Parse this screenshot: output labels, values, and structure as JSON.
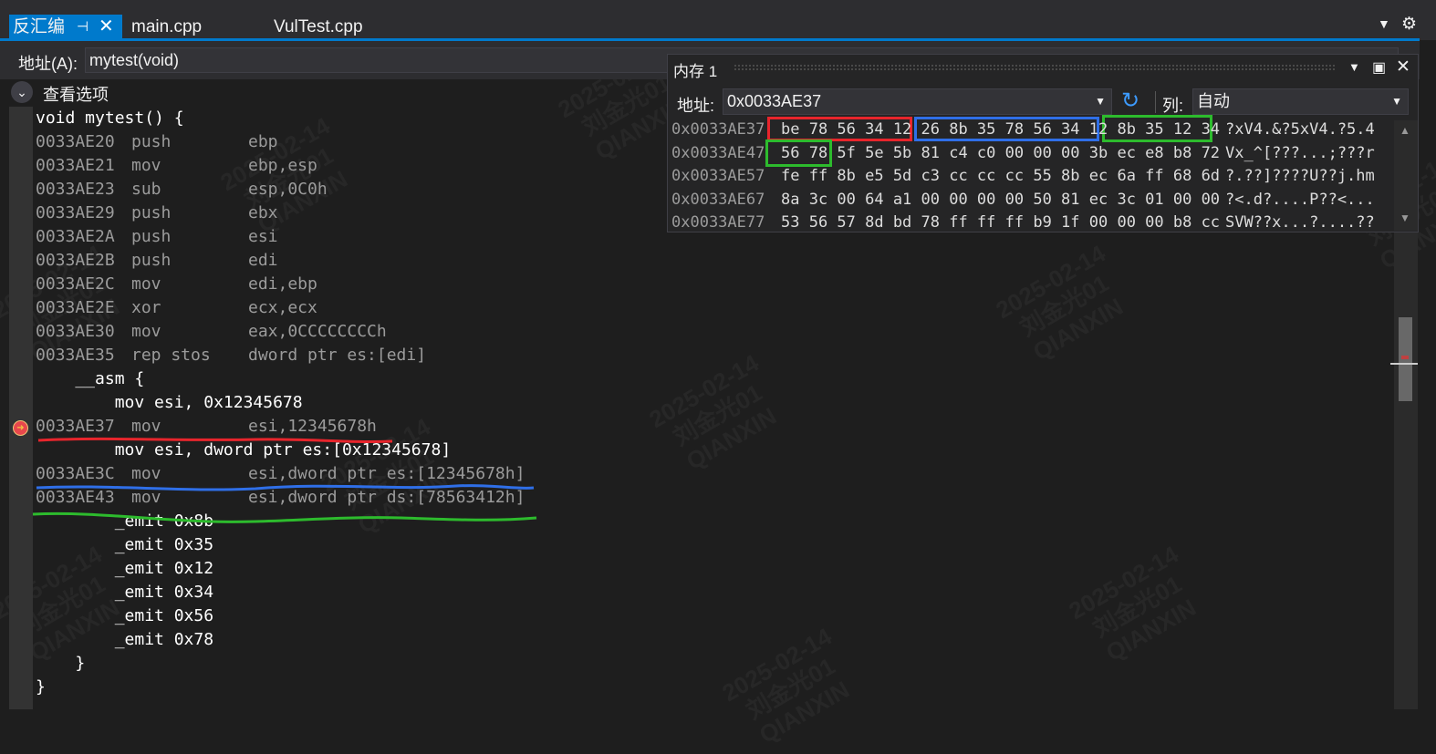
{
  "tabs": {
    "active": {
      "label": "反汇编",
      "pin": "⊣",
      "close": "✕"
    },
    "main": {
      "label": "main.cpp"
    },
    "vultest": {
      "label": "VulTest.cpp"
    }
  },
  "address_bar": {
    "label": "地址(A):",
    "value": "mytest(void)"
  },
  "view_options": {
    "label": "查看选项"
  },
  "code_lines": [
    {
      "type": "src",
      "text": "void mytest() {"
    },
    {
      "type": "dis",
      "addr": "0033AE20",
      "mnem": "push",
      "ops": "ebp"
    },
    {
      "type": "dis",
      "addr": "0033AE21",
      "mnem": "mov",
      "ops": "ebp,esp"
    },
    {
      "type": "dis",
      "addr": "0033AE23",
      "mnem": "sub",
      "ops": "esp,0C0h"
    },
    {
      "type": "dis",
      "addr": "0033AE29",
      "mnem": "push",
      "ops": "ebx"
    },
    {
      "type": "dis",
      "addr": "0033AE2A",
      "mnem": "push",
      "ops": "esi"
    },
    {
      "type": "dis",
      "addr": "0033AE2B",
      "mnem": "push",
      "ops": "edi"
    },
    {
      "type": "dis",
      "addr": "0033AE2C",
      "mnem": "mov",
      "ops": "edi,ebp"
    },
    {
      "type": "dis",
      "addr": "0033AE2E",
      "mnem": "xor",
      "ops": "ecx,ecx"
    },
    {
      "type": "dis",
      "addr": "0033AE30",
      "mnem": "mov",
      "ops": "eax,0CCCCCCCCh"
    },
    {
      "type": "dis",
      "addr": "0033AE35",
      "mnem": "rep stos",
      "ops": "dword ptr es:[edi]"
    },
    {
      "type": "src",
      "text": "    __asm {"
    },
    {
      "type": "src",
      "text": "        mov esi, 0x12345678"
    },
    {
      "type": "dis",
      "addr": "0033AE37",
      "mnem": "mov",
      "ops": "esi,12345678h"
    },
    {
      "type": "src",
      "text": "        mov esi, dword ptr es:[0x12345678]"
    },
    {
      "type": "dis",
      "addr": "0033AE3C",
      "mnem": "mov",
      "ops": "esi,dword ptr es:[12345678h]"
    },
    {
      "type": "dis",
      "addr": "0033AE43",
      "mnem": "mov",
      "ops": "esi,dword ptr ds:[78563412h]"
    },
    {
      "type": "src",
      "text": "        _emit 0x8b"
    },
    {
      "type": "src",
      "text": "        _emit 0x35"
    },
    {
      "type": "src",
      "text": "        _emit 0x12"
    },
    {
      "type": "src",
      "text": "        _emit 0x34"
    },
    {
      "type": "src",
      "text": "        _emit 0x56"
    },
    {
      "type": "src",
      "text": "        _emit 0x78"
    },
    {
      "type": "src",
      "text": "    }"
    },
    {
      "type": "src",
      "text": "}"
    }
  ],
  "memory": {
    "title": "内存 1",
    "addr_label": "地址:",
    "addr_value": "0x0033AE37",
    "col_label": "列:",
    "col_value": "自动",
    "rows": [
      {
        "addr": "0x0033AE37",
        "bytes": "be 78 56 34 12 26 8b 35 78 56 34 12 8b 35 12 34",
        "ascii": "?xV4.&?5xV4.?5.4"
      },
      {
        "addr": "0x0033AE47",
        "bytes": "56 78 5f 5e 5b 81 c4 c0 00 00 00 3b ec e8 b8 72",
        "ascii": "Vx_^[???...;???r"
      },
      {
        "addr": "0x0033AE57",
        "bytes": "fe ff 8b e5 5d c3 cc cc cc 55 8b ec 6a ff 68 6d",
        "ascii": "?.??]????U??j.hm"
      },
      {
        "addr": "0x0033AE67",
        "bytes": "8a 3c 00 64 a1 00 00 00 00 50 81 ec 3c 01 00 00",
        "ascii": "?<.d?....P??<..."
      },
      {
        "addr": "0x0033AE77",
        "bytes": "53 56 57 8d bd 78 ff ff ff b9 1f 00 00 00 b8 cc",
        "ascii": "SVW??x...?....??"
      }
    ]
  },
  "watermark": {
    "date": "2025-02-14",
    "name": "刘金光01",
    "org": "QIANXIN"
  },
  "colors": {
    "accent": "#007acc",
    "red": "#e8252c",
    "blue": "#2f6fe8",
    "green": "#2dbb2d"
  },
  "icons": {
    "breakpoint": "breakpoint-icon",
    "refresh": "refresh-icon",
    "gear": "gear-icon"
  }
}
